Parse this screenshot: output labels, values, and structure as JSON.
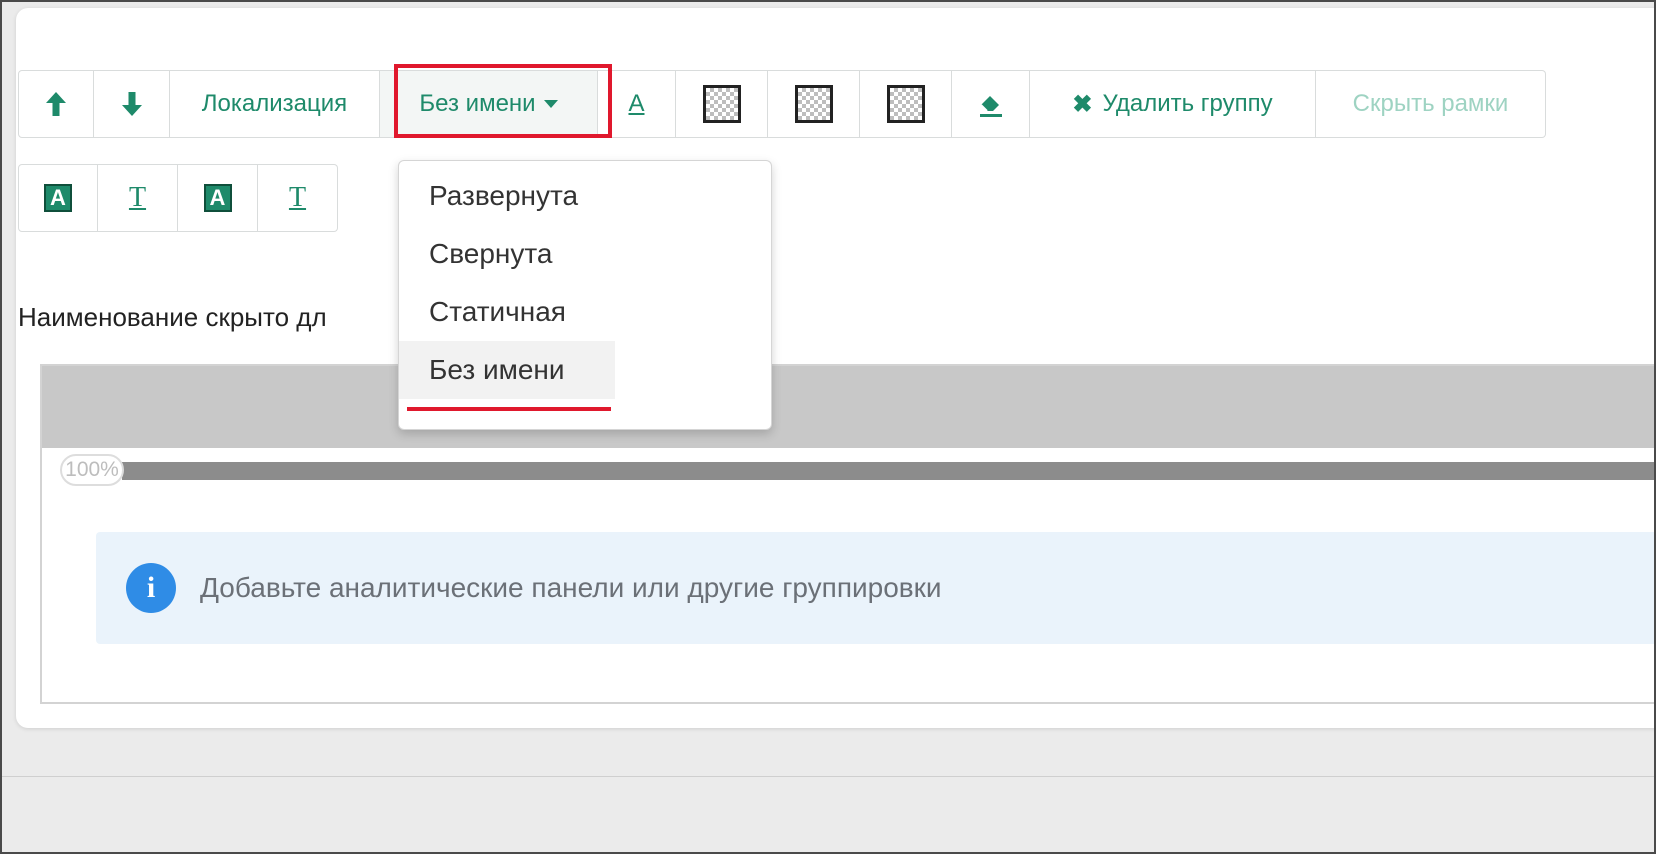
{
  "toolbar": {
    "move_up_icon": "arrow-up",
    "move_down_icon": "arrow-down",
    "localization_label": "Локализация",
    "mode_select_label": "Без имени",
    "delete_group_label": "Удалить группу",
    "hide_frames_label": "Скрыть рамки"
  },
  "dropdown": {
    "items": [
      {
        "label": "Развернута"
      },
      {
        "label": "Свернута"
      },
      {
        "label": "Статичная"
      },
      {
        "label": "Без имени"
      }
    ],
    "selected": "Без имени"
  },
  "caption": "Наименование скрыто дл",
  "progress": {
    "label": "100%",
    "value": 100
  },
  "info": {
    "text": "Добавьте аналитические панели или другие группировки"
  },
  "colors": {
    "accent": "#1e8a6a",
    "highlight": "#e0182d",
    "info_icon": "#2f8ce6",
    "info_bg": "#eaf3fb"
  }
}
